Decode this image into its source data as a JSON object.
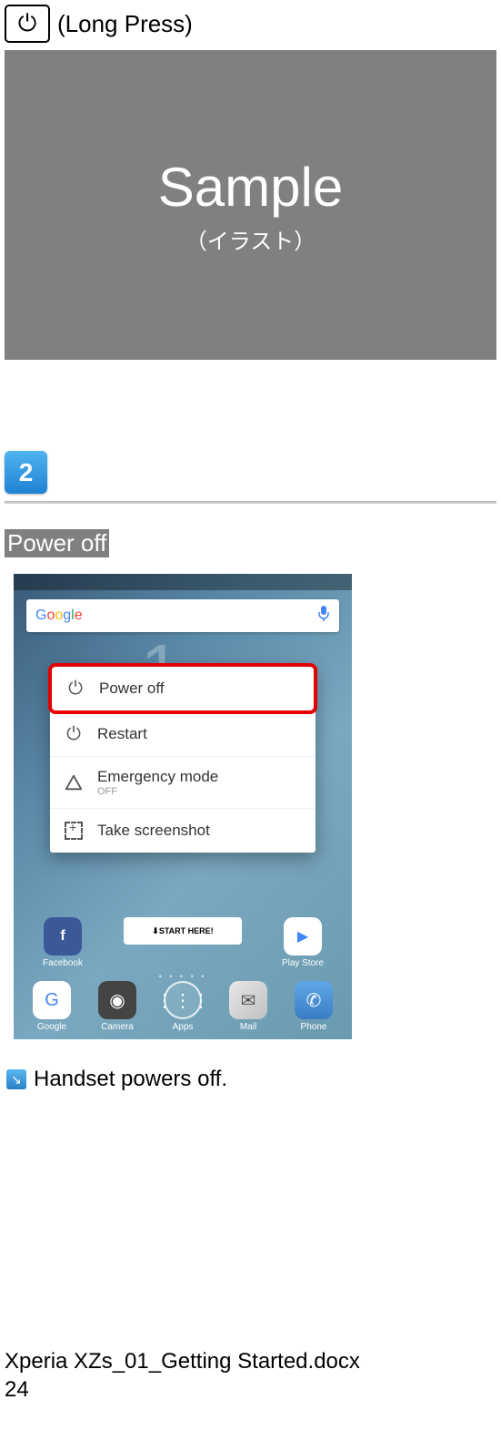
{
  "top": {
    "long_press": "(Long Press)"
  },
  "sample": {
    "title": "Sample",
    "subtitle": "（イラスト）"
  },
  "step_two": {
    "number": "2"
  },
  "power_off_label": "Power off",
  "menu": {
    "power_off": "Power off",
    "restart": "Restart",
    "emergency": "Emergency mode",
    "emergency_sub": "OFF",
    "screenshot": "Take screenshot"
  },
  "search": {
    "brand": "Google"
  },
  "upper_dock": {
    "facebook": "Facebook",
    "startbanner": "START HERE!",
    "playstore": "Play Store"
  },
  "dock": {
    "google": "Google",
    "camera": "Camera",
    "apps": "Apps",
    "mail": "Mail",
    "phone": "Phone"
  },
  "note": {
    "text": "Handset powers off."
  },
  "footer": {
    "filename": "Xperia XZs_01_Getting Started.docx",
    "page": "24"
  }
}
